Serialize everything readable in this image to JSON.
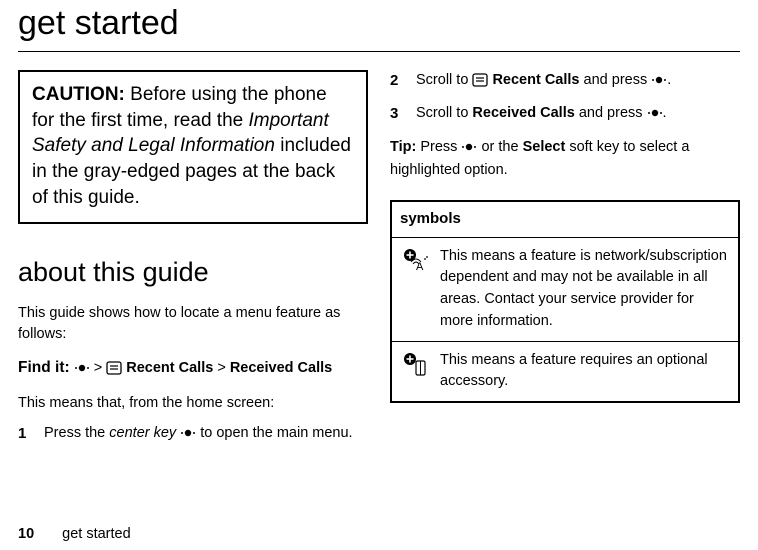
{
  "title": "get started",
  "left": {
    "caution": {
      "lead": "CAUTION:",
      "t1": " Before using the phone for the first time, read the ",
      "italic": "Important Safety and Legal Information",
      "t2": " included in the gray-edged pages at the back of this guide."
    },
    "h2": "about this guide",
    "intro": "This guide shows how to locate a menu feature as follows:",
    "findit_lead": "Find it:",
    "path_a": " Recent Calls",
    "path_b": "Received Calls",
    "explain": "This means that, from the home screen:",
    "step1_num": "1",
    "step1_a": "Press the ",
    "step1_b": "center key ",
    "step1_c": " to open the main menu."
  },
  "right": {
    "step2_num": "2",
    "step2_a": "Scroll to ",
    "step2_b": " Recent Calls",
    "step2_c": " and press ",
    "step2_d": ".",
    "step3_num": "3",
    "step3_a": "Scroll to ",
    "step3_b": "Received Calls",
    "step3_c": " and press ",
    "step3_d": ".",
    "tip_lead": "Tip:",
    "tip_a": " Press ",
    "tip_b": " or the ",
    "tip_c": "Select",
    "tip_d": " soft key to select a highlighted option.",
    "sym_header": "symbols",
    "sym1": "This means a feature is network/subscription dependent and may not be available in all areas. Contact your service provider for more information.",
    "sym2": "This means a feature requires an optional accessory."
  },
  "footer": {
    "page": "10",
    "section": "get started"
  }
}
